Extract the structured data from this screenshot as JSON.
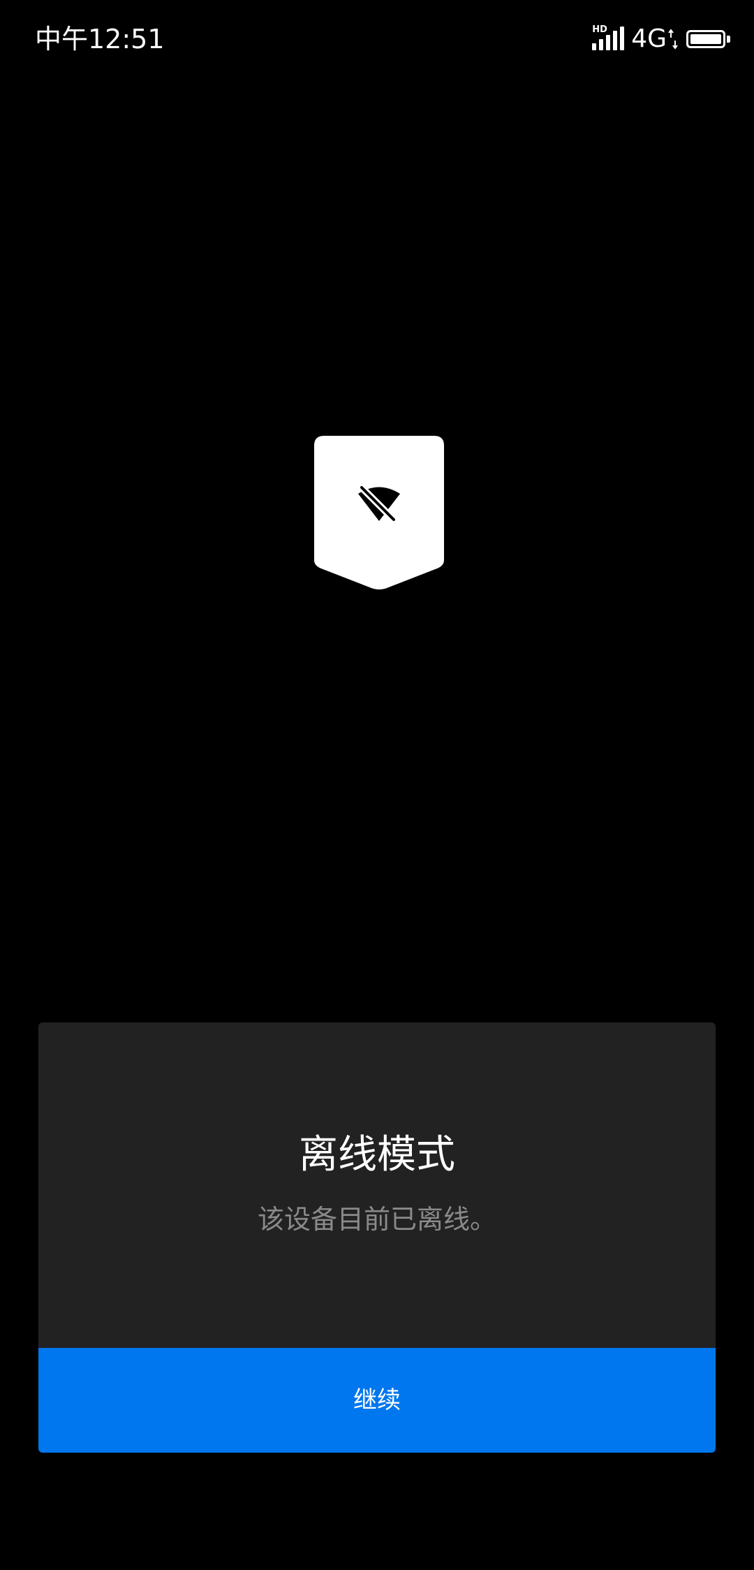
{
  "status_bar": {
    "time": "中午12:51",
    "hd_label": "HD",
    "network_type": "4G",
    "icons": [
      "signal-icon",
      "network-arrows-icon",
      "battery-icon"
    ]
  },
  "badge": {
    "icon": "wifi-off-icon"
  },
  "dialog": {
    "title": "离线模式",
    "message": "该设备目前已离线。",
    "continue_label": "继续"
  },
  "colors": {
    "background": "#000000",
    "card": "#222222",
    "button": "#0077ee",
    "title_text": "#ffffff",
    "message_text": "#8a8a8a"
  }
}
